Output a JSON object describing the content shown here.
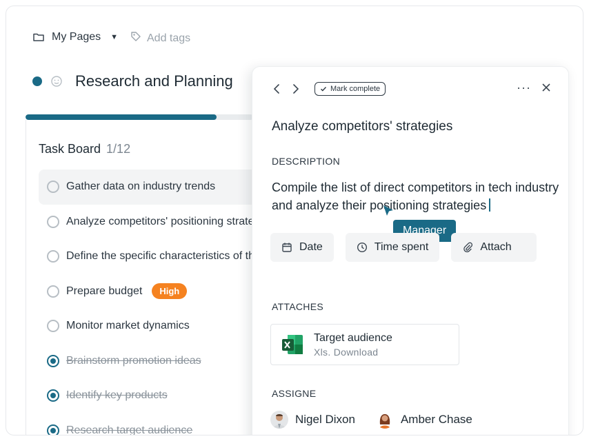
{
  "breadcrumb": {
    "folder_label": "My Pages",
    "tags_placeholder": "Add tags"
  },
  "page": {
    "title": "Research and Planning",
    "status_color": "#1a6a86",
    "progress_fraction": 0.84
  },
  "board": {
    "title": "Task Board",
    "count": "1/12",
    "tasks": [
      {
        "label": "Gather data on industry trends",
        "done": false
      },
      {
        "label": "Analyze competitors' positioning strategies",
        "done": false
      },
      {
        "label": "Define the specific characteristics of the target audience",
        "done": false
      },
      {
        "label": "Prepare budget",
        "done": false,
        "badge": "High"
      },
      {
        "label": "Monitor market dynamics",
        "done": false
      },
      {
        "label": "Brainstorm promotion ideas",
        "done": true
      },
      {
        "label": "Identify key products",
        "done": true
      },
      {
        "label": "Research target audience",
        "done": true
      }
    ]
  },
  "panel": {
    "mark_complete_label": "Mark complete",
    "task_title": "Analyze competitors' strategies",
    "description_label": "DESCRIPTION",
    "description_text": "Compile the list of direct competitors in tech industry and analyze their positioning strategies",
    "tooltip": "Manager",
    "chips": {
      "date": "Date",
      "time_spent": "Time spent",
      "attach": "Attach"
    },
    "attaches_label": "ATTACHES",
    "file": {
      "name": "Target audience",
      "sub": "Xls. Download"
    },
    "assigne_label": "ASSIGNE",
    "assignees": [
      "Nigel Dixon",
      "Amber Chase"
    ]
  },
  "colors": {
    "accent": "#1a6a86",
    "badge_high": "#f58220",
    "excel_green": "#1f7a45"
  },
  "icons": [
    "folder-icon",
    "caret-down-icon",
    "tag-icon",
    "smile-icon",
    "chevron-left-icon",
    "chevron-right-icon",
    "check-icon",
    "more-icon",
    "close-icon",
    "calendar-icon",
    "clock-icon",
    "paperclip-icon",
    "excel-icon",
    "cursor-icon"
  ]
}
